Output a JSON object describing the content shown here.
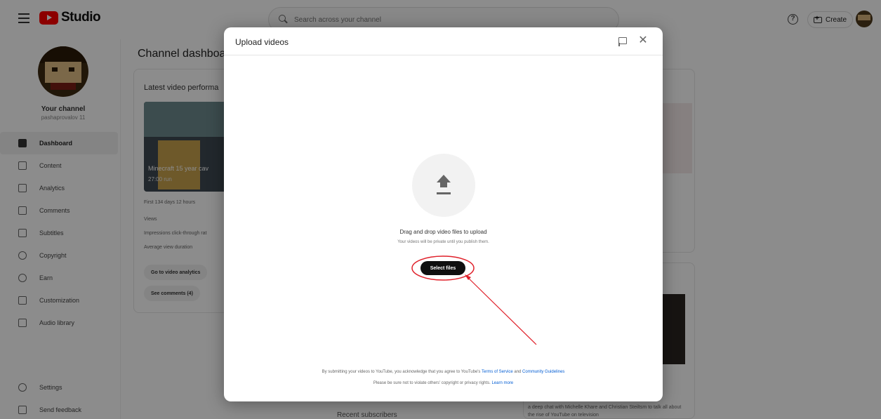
{
  "app": {
    "logo_text": "Studio",
    "brand_color": "#ff0000"
  },
  "search": {
    "placeholder": "Search across your channel"
  },
  "header": {
    "create_label": "Create",
    "help_icon": "?"
  },
  "sidebar": {
    "channel_name": "Your channel",
    "channel_handle": "pashaprovalov 11",
    "items": [
      {
        "label": "Dashboard",
        "icon": "dashboard-icon",
        "active": true
      },
      {
        "label": "Content",
        "icon": "content-icon"
      },
      {
        "label": "Analytics",
        "icon": "analytics-icon"
      },
      {
        "label": "Comments",
        "icon": "comments-icon"
      },
      {
        "label": "Subtitles",
        "icon": "subtitles-icon"
      },
      {
        "label": "Copyright",
        "icon": "copyright-icon"
      },
      {
        "label": "Earn",
        "icon": "earn-icon"
      },
      {
        "label": "Customization",
        "icon": "customization-icon"
      },
      {
        "label": "Audio library",
        "icon": "audio-library-icon"
      }
    ],
    "bottom_items": [
      {
        "label": "Settings",
        "icon": "settings-icon"
      },
      {
        "label": "Send feedback",
        "icon": "feedback-icon"
      }
    ]
  },
  "main": {
    "title": "Channel dashboar",
    "card_title": "Latest video performa",
    "video_title": "Minecraft 15 year cav",
    "video_duration": "27:00 run",
    "stats": [
      "First 134 days 12 hours",
      "Views",
      "Impressions click-through rat",
      "Average view duration"
    ],
    "buttons": [
      "Go to video analytics",
      "See comments (4)"
    ],
    "feed_text": "a deep chat with Michelle Khare and Christian Steiltsm to talk all about the rise of YouTube on television",
    "bottom_title": "Recent subscribers"
  },
  "modal": {
    "title": "Upload videos",
    "drag_text": "Drag and drop video files to upload",
    "private_text": "Your videos will be private until you publish them.",
    "select_label": "Select files",
    "legal_prefix": "By submitting your videos to YouTube, you acknowledge that you agree to YouTube's",
    "terms_link": "Terms of Service",
    "legal_and": "and",
    "guidelines_link": "Community Guidelines",
    "legal2_prefix": "Please be sure not to violate others' copyright or privacy rights.",
    "learn_more": "Learn more",
    "close_glyph": "✕"
  },
  "annotation": {
    "color": "#e0202a"
  }
}
